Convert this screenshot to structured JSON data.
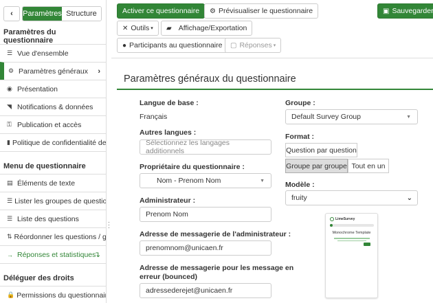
{
  "sidebar": {
    "collapse_glyph": "‹",
    "toggle": {
      "active": "Paramètres",
      "inactive": "Structure"
    },
    "sections": [
      {
        "heading": "Paramètres du questionnaire",
        "items": [
          {
            "icon": "list-icon",
            "glyph": "☰",
            "label": "Vue d'ensemble"
          },
          {
            "icon": "gears-icon",
            "glyph": "⚙",
            "label": "Paramètres généraux",
            "selected": true,
            "right": "›"
          },
          {
            "icon": "eye-icon",
            "glyph": "◉",
            "label": "Présentation"
          },
          {
            "icon": "rss-icon",
            "glyph": "◥",
            "label": "Notifications & données"
          },
          {
            "icon": "key-icon",
            "glyph": "⚿",
            "label": "Publication et accès"
          },
          {
            "icon": "shield-icon",
            "glyph": "▮",
            "label": "Politique de confidentialité des d"
          }
        ]
      },
      {
        "heading": "Menu de questionnaire",
        "items": [
          {
            "icon": "file-text-icon",
            "glyph": "▤",
            "label": "Éléments de texte"
          },
          {
            "icon": "list-icon",
            "glyph": "☰",
            "label": "Lister les groupes de questions"
          },
          {
            "icon": "list-icon",
            "glyph": "☰",
            "label": "Liste des questions"
          },
          {
            "icon": "sort-icon",
            "glyph": "⇅",
            "label": "Réordonner les questions / grou"
          },
          {
            "icon": "arrow-right-icon",
            "glyph": "→",
            "label": "Réponses et statistiques",
            "green": true,
            "right": "↴"
          }
        ]
      },
      {
        "heading": "Déléguer des droits",
        "items": [
          {
            "icon": "lock-icon",
            "glyph": "🔒",
            "label": "Permissions du questionnaire"
          }
        ]
      }
    ]
  },
  "toolbar": {
    "activate": "Activer ce questionnaire",
    "preview": "Prévisualiser le questionnaire",
    "save": "Sauvegarder",
    "tools": "Outils",
    "display_export": "Affichage/Exportation",
    "participants": "Participants au questionnaire",
    "responses": "Réponses"
  },
  "main": {
    "title": "Paramètres généraux du questionnaire",
    "base_language": {
      "label": "Langue de base :",
      "value": "Français"
    },
    "other_languages": {
      "label": "Autres langues :",
      "placeholder": "Sélectionnez les langages additionnels"
    },
    "owner": {
      "label": "Propriétaire du questionnaire :",
      "value": "Nom -  Prenom Nom"
    },
    "administrator": {
      "label": "Administrateur :",
      "value": "Prenom Nom"
    },
    "admin_email": {
      "label": "Adresse de messagerie de l'administrateur :",
      "value": "prenomnom@unicaen.fr"
    },
    "bounce_email": {
      "label_line1": "Adresse de messagerie pour les message en",
      "label_line2": "erreur (bounced)",
      "value": "adressederejet@unicaen.fr"
    },
    "group": {
      "label": "Groupe :",
      "value": "Default Survey Group"
    },
    "format": {
      "label": "Format :",
      "options": [
        "Question par question",
        "Groupe par groupe",
        "Tout en un"
      ],
      "selected": "Groupe par groupe"
    },
    "template": {
      "label": "Modèle :",
      "value": "fruity"
    },
    "preview_card": {
      "logo": "LimeSurvey",
      "title": "Monochrome Template"
    }
  },
  "colors": {
    "accent": "#328637"
  }
}
